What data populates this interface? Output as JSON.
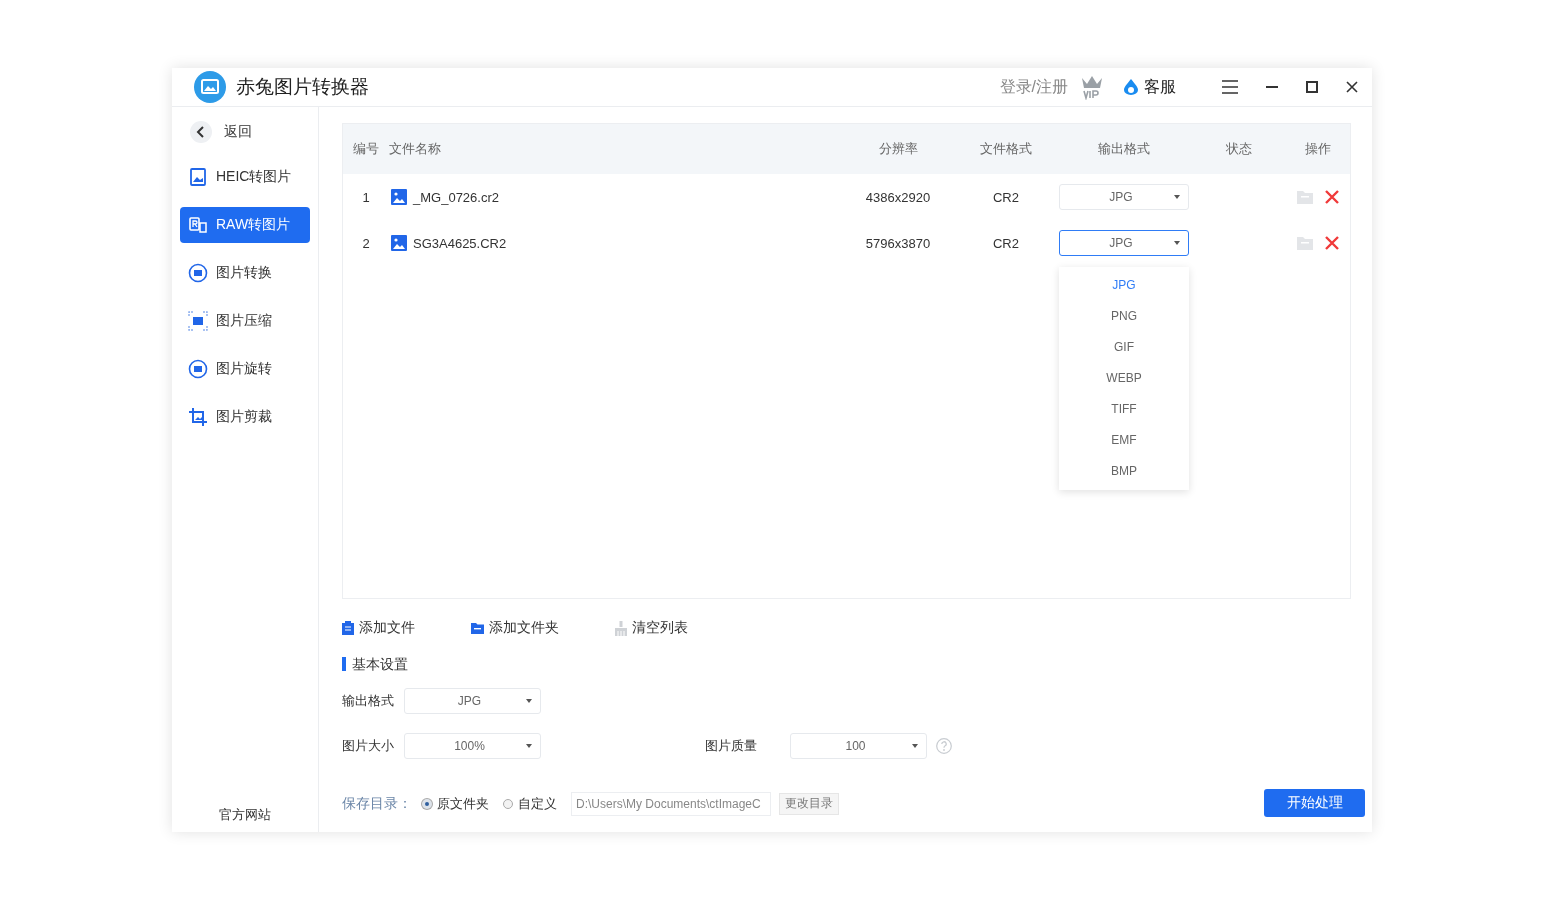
{
  "window": {
    "title": "赤兔图片转换器",
    "login": "登录/注册",
    "service": "客服"
  },
  "sidebar": {
    "back": "返回",
    "items": [
      {
        "label": "HEIC转图片",
        "kind": "heic",
        "selected": false
      },
      {
        "label": "RAW转图片",
        "kind": "raw",
        "selected": true
      },
      {
        "label": "图片转换",
        "kind": "convert",
        "selected": false
      },
      {
        "label": "图片压缩",
        "kind": "compress",
        "selected": false
      },
      {
        "label": "图片旋转",
        "kind": "rotate",
        "selected": false
      },
      {
        "label": "图片剪裁",
        "kind": "crop",
        "selected": false
      }
    ],
    "footer": "官方网站"
  },
  "table": {
    "columns": [
      "编号",
      "文件名称",
      "分辨率",
      "文件格式",
      "输出格式",
      "状态",
      "操作"
    ],
    "rows": [
      {
        "index": "1",
        "name": "_MG_0726.cr2",
        "resolution": "4386x2920",
        "format": "CR2",
        "output": "JPG",
        "open": false
      },
      {
        "index": "2",
        "name": "SG3A4625.CR2",
        "resolution": "5796x3870",
        "format": "CR2",
        "output": "JPG",
        "open": true
      }
    ]
  },
  "dropdown": {
    "options": [
      {
        "label": "JPG",
        "selected": true
      },
      {
        "label": "PNG",
        "selected": false
      },
      {
        "label": "GIF",
        "selected": false
      },
      {
        "label": "WEBP",
        "selected": false
      },
      {
        "label": "TIFF",
        "selected": false
      },
      {
        "label": "EMF",
        "selected": false
      },
      {
        "label": "BMP",
        "selected": false
      }
    ]
  },
  "actions": [
    {
      "label": "添加文件",
      "kind": "file"
    },
    {
      "label": "添加文件夹",
      "kind": "folder"
    },
    {
      "label": "清空列表",
      "kind": "clear"
    }
  ],
  "settings": {
    "title": "基本设置",
    "output_label": "输出格式",
    "output_value": "JPG",
    "size_label": "图片大小",
    "size_value": "100%",
    "quality_label": "图片质量",
    "quality_value": "100"
  },
  "save": {
    "label": "保存目录：",
    "options": [
      {
        "label": "原文件夹",
        "selected": true
      },
      {
        "label": "自定义",
        "selected": false
      }
    ],
    "path": "D:\\Users\\My Documents\\ctImageC",
    "change": "更改目录"
  },
  "start": "开始处理"
}
